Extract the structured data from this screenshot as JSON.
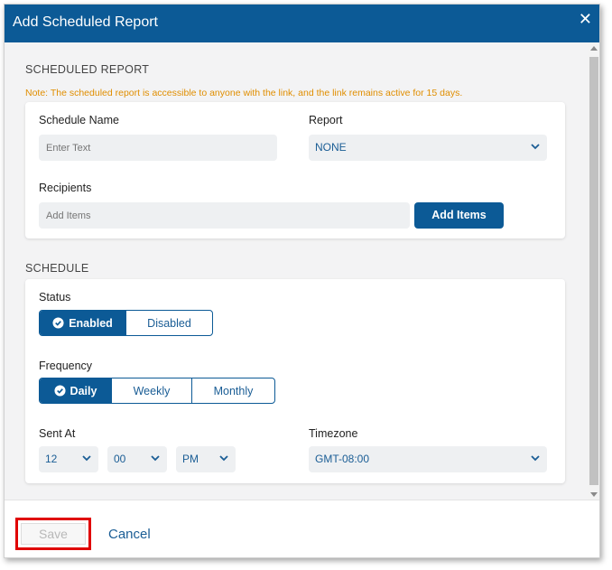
{
  "dialog": {
    "title": "Add Scheduled Report",
    "close": "✕"
  },
  "scheduled_report": {
    "section_title": "SCHEDULED REPORT",
    "note": "Note: The scheduled report is accessible to anyone with the link, and the link remains active for 15 days.",
    "schedule_name": {
      "label": "Schedule Name",
      "placeholder": "Enter Text",
      "value": ""
    },
    "report": {
      "label": "Report",
      "value": "NONE"
    },
    "recipients": {
      "label": "Recipients",
      "placeholder": "Add Items",
      "button": "Add Items"
    }
  },
  "schedule": {
    "section_title": "SCHEDULE",
    "status": {
      "label": "Status",
      "options": [
        "Enabled",
        "Disabled"
      ],
      "selected": "Enabled"
    },
    "frequency": {
      "label": "Frequency",
      "options": [
        "Daily",
        "Weekly",
        "Monthly"
      ],
      "selected": "Daily"
    },
    "sent_at": {
      "label": "Sent At",
      "hour": "12",
      "minute": "00",
      "ampm": "PM"
    },
    "timezone": {
      "label": "Timezone",
      "value": "GMT-08:00"
    }
  },
  "footer": {
    "save": "Save",
    "cancel": "Cancel"
  },
  "colors": {
    "primary": "#0c5a96",
    "note": "#e08e00",
    "highlight": "#e00000"
  }
}
